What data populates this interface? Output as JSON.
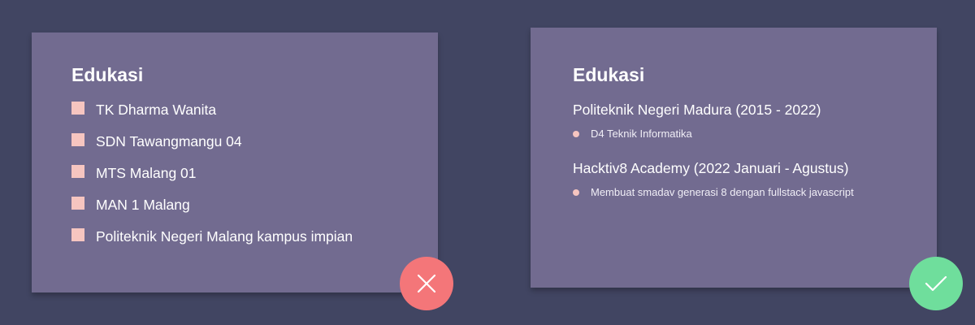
{
  "left_card": {
    "title": "Edukasi",
    "items": [
      "TK Dharma Wanita",
      "SDN Tawangmangu 04",
      "MTS Malang 01",
      "MAN 1 Malang",
      "Politeknik Negeri Malang kampus impian"
    ]
  },
  "right_card": {
    "title": "Edukasi",
    "entries": [
      {
        "title": "Politeknik Negeri Madura (2015 - 2022)",
        "detail": "D4 Teknik Informatika"
      },
      {
        "title": "Hacktiv8 Academy (2022 Januari - Agustus)",
        "detail": "Membuat smadav generasi 8 dengan fullstack javascript"
      }
    ]
  },
  "badges": {
    "wrong_icon": "close-icon",
    "right_icon": "check-icon",
    "wrong_color": "#f47679",
    "right_color": "#6fde9c"
  },
  "colors": {
    "background": "#414562",
    "card": "#726b90",
    "bullet": "#f6c5c0"
  }
}
